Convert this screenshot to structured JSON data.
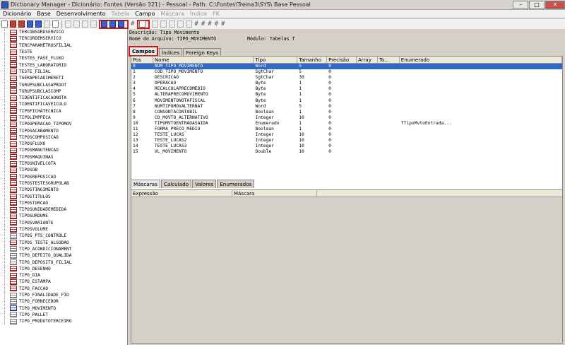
{
  "window": {
    "title": "Dictionary Manager - Dicionário: Fontes (Versão 321) - Pessoal - Path: C:\\Fontes\\Treina3\\SYS\\ Base Pessoal",
    "minimize": "–",
    "maximize": "□",
    "close": "✕"
  },
  "menu": [
    {
      "label": "Dicionário",
      "enabled": true
    },
    {
      "label": "Base",
      "enabled": true
    },
    {
      "label": "Desenvolvimento",
      "enabled": true
    },
    {
      "label": "Tabela",
      "enabled": false
    },
    {
      "label": "Campo",
      "enabled": true
    },
    {
      "label": "Máscara",
      "enabled": false
    },
    {
      "label": "Índice",
      "enabled": false
    },
    {
      "label": "FK",
      "enabled": false
    }
  ],
  "toolbar": {
    "hash": "#",
    "ghost_glyphs": [
      "#",
      "#",
      "#",
      "#",
      "#"
    ]
  },
  "tree": [
    {
      "label": "TERCOBSORDSERVICO",
      "icon": "red"
    },
    {
      "label": "TERCORDEMSERVICO",
      "icon": "red"
    },
    {
      "label": "TERCPARAMETROSFILIAL",
      "icon": "red"
    },
    {
      "label": "TESTE",
      "icon": "red"
    },
    {
      "label": "TESTES_FASE_FLUXO",
      "icon": "red"
    },
    {
      "label": "TESTES_LABORATORIO",
      "icon": "red"
    },
    {
      "label": "TESTE_FILIAL",
      "icon": "red"
    },
    {
      "label": "TGERAPECADIMERETI",
      "icon": "red"
    },
    {
      "label": "TGRUPSUBCLASAPROOT",
      "icon": "red"
    },
    {
      "label": "TGRUPSUBCLASCOMP",
      "icon": "red"
    },
    {
      "label": "TIDENTIFICACAONOTA",
      "icon": "red"
    },
    {
      "label": "TIDENTIFICAVEICULO",
      "icon": "red"
    },
    {
      "label": "TIPOFICHATECNICA",
      "icon": "red"
    },
    {
      "label": "TIPOLIMPPECA",
      "icon": "red"
    },
    {
      "label": "TIPOOPERACAO_TIPOMOV",
      "icon": "red"
    },
    {
      "label": "TIPOSACABAMENTO",
      "icon": "red"
    },
    {
      "label": "TIPOSCOMPOSICAO",
      "icon": "red"
    },
    {
      "label": "TIPOSFLUXO",
      "icon": "red"
    },
    {
      "label": "TIPOSMANUTENCAO",
      "icon": "red"
    },
    {
      "label": "TIPOSMAQUINAS",
      "icon": "red"
    },
    {
      "label": "TIPOSNIVELCOTA",
      "icon": "red"
    },
    {
      "label": "TIPOSOB",
      "icon": "red"
    },
    {
      "label": "TIPOSREPOSICAO",
      "icon": "red"
    },
    {
      "label": "TIPOSTESTESGRUPOLAB",
      "icon": "red"
    },
    {
      "label": "TIPOSTINGIMENTO",
      "icon": "red"
    },
    {
      "label": "TIPOSTITULOS",
      "icon": "red"
    },
    {
      "label": "TIPOSTORCAO",
      "icon": "red"
    },
    {
      "label": "TIPOSUNIDADEMEDIDA",
      "icon": "red"
    },
    {
      "label": "TIPOSURDUME",
      "icon": "red"
    },
    {
      "label": "TIPOSVARIANTE",
      "icon": "red"
    },
    {
      "label": "TIPOSVOLUME",
      "icon": "red"
    },
    {
      "label": "TIPOS_PTS_CONTROLE",
      "icon": "gray"
    },
    {
      "label": "TIPOS_TESTE_ALGODAO",
      "icon": "red"
    },
    {
      "label": "TIPO_ACONDICIONAMENT",
      "icon": "gray"
    },
    {
      "label": "TIPO_DEFEITO_QUALIDA",
      "icon": "gray"
    },
    {
      "label": "TIPO_DEPOSITO_FILIAL",
      "icon": "gray"
    },
    {
      "label": "TIPO_DESENHO",
      "icon": "red"
    },
    {
      "label": "TIPO_DIA",
      "icon": "red"
    },
    {
      "label": "TIPO_ESTAMPA",
      "icon": "red"
    },
    {
      "label": "TIPO_FACCAO",
      "icon": "red"
    },
    {
      "label": "TIPO_FINALIDADE_FIO",
      "icon": "gray"
    },
    {
      "label": "TIPO_FORNECEDOR",
      "icon": "gray"
    },
    {
      "label": "TIPO_MOVIMENTO",
      "icon": "blue"
    },
    {
      "label": "TIPO_PALLET",
      "icon": "gray"
    },
    {
      "label": "TIPO_PRODUTOTERCEIRO",
      "icon": "gray"
    }
  ],
  "info": {
    "descricao": "Descrição: Tipo Movimento",
    "arquivo": "Nome do Arquivo: TIPO_MOVIMENTO",
    "modulo": "Módulo: Tabelas T"
  },
  "top_tabs": [
    {
      "label": "Campos",
      "active": true
    },
    {
      "label": "Índices",
      "active": false
    },
    {
      "label": "Foreign Keys",
      "active": false
    }
  ],
  "fields_grid": {
    "columns": [
      "Pos",
      "Nome",
      "Tipo",
      "Tamanho",
      "Precisão",
      "Array",
      "To...",
      "Enumerado"
    ],
    "rows": [
      {
        "pos": "0",
        "nome": "NUM_TIPO_MOVIMENTO",
        "tipo": "Word",
        "tamanho": "5",
        "precisao": "0",
        "array": "",
        "to": "",
        "enumerado": "",
        "selected": true
      },
      {
        "pos": "1",
        "nome": "COD_TIPO_MOVIMENTO",
        "tipo": "SgtChar",
        "tamanho": "5",
        "precisao": "0",
        "array": "",
        "to": "",
        "enumerado": ""
      },
      {
        "pos": "2",
        "nome": "DESCRICAO",
        "tipo": "SgtChar",
        "tamanho": "30",
        "precisao": "0",
        "array": "",
        "to": "",
        "enumerado": ""
      },
      {
        "pos": "3",
        "nome": "OPERACAO",
        "tipo": "Byte",
        "tamanho": "1",
        "precisao": "0",
        "array": "",
        "to": "",
        "enumerado": ""
      },
      {
        "pos": "4",
        "nome": "RECALCULAPRECOMEDIO",
        "tipo": "Byte",
        "tamanho": "1",
        "precisao": "0",
        "array": "",
        "to": "",
        "enumerado": ""
      },
      {
        "pos": "5",
        "nome": "ALTERAPRECOMOVIMENTO",
        "tipo": "Byte",
        "tamanho": "1",
        "precisao": "0",
        "array": "",
        "to": "",
        "enumerado": ""
      },
      {
        "pos": "6",
        "nome": "MOVIMENTONOTAFISCAL",
        "tipo": "Byte",
        "tamanho": "1",
        "precisao": "0",
        "array": "",
        "to": "",
        "enumerado": ""
      },
      {
        "pos": "7",
        "nome": "NUMTIPOMOVALTERNAT",
        "tipo": "Word",
        "tamanho": "5",
        "precisao": "0",
        "array": "",
        "to": "",
        "enumerado": ""
      },
      {
        "pos": "8",
        "nome": "CONSONTACONTABIL",
        "tipo": "Boolean",
        "tamanho": "1",
        "precisao": "0",
        "array": "",
        "to": "",
        "enumerado": ""
      },
      {
        "pos": "9",
        "nome": "CD_MOVTO_ALTERNATIVO",
        "tipo": "Integer",
        "tamanho": "10",
        "precisao": "0",
        "array": "",
        "to": "",
        "enumerado": ""
      },
      {
        "pos": "10",
        "nome": "TIPOMVTOENTRADASAIDA",
        "tipo": "Enumerado",
        "tamanho": "1",
        "precisao": "0",
        "array": "",
        "to": "",
        "enumerado": "TTipoMvtoEntrada..."
      },
      {
        "pos": "11",
        "nome": "FORMA_PRECO_MEDIO",
        "tipo": "Boolean",
        "tamanho": "1",
        "precisao": "0",
        "array": "",
        "to": "",
        "enumerado": ""
      },
      {
        "pos": "12",
        "nome": "TESTE_LUCAS",
        "tipo": "Integer",
        "tamanho": "10",
        "precisao": "0",
        "array": "",
        "to": "",
        "enumerado": ""
      },
      {
        "pos": "13",
        "nome": "TESTE_LUCAS2",
        "tipo": "Integer",
        "tamanho": "10",
        "precisao": "0",
        "array": "",
        "to": "",
        "enumerado": ""
      },
      {
        "pos": "14",
        "nome": "TESTE_LUCAS3",
        "tipo": "Integer",
        "tamanho": "10",
        "precisao": "0",
        "array": "",
        "to": "",
        "enumerado": ""
      },
      {
        "pos": "15",
        "nome": "VL_MOVIMENTO",
        "tipo": "Double",
        "tamanho": "10",
        "precisao": "0",
        "array": "",
        "to": "",
        "enumerado": ""
      }
    ]
  },
  "bottom_tabs": [
    {
      "label": "Máscaras",
      "active": true
    },
    {
      "label": "Calculado",
      "active": false
    },
    {
      "label": "Valores",
      "active": false
    },
    {
      "label": "Enumerados",
      "active": false
    }
  ],
  "mask_grid": {
    "columns": [
      "Expressão",
      "Máscara"
    ]
  },
  "colors": {
    "selection": "#3169c6",
    "highlight": "#d01818"
  }
}
